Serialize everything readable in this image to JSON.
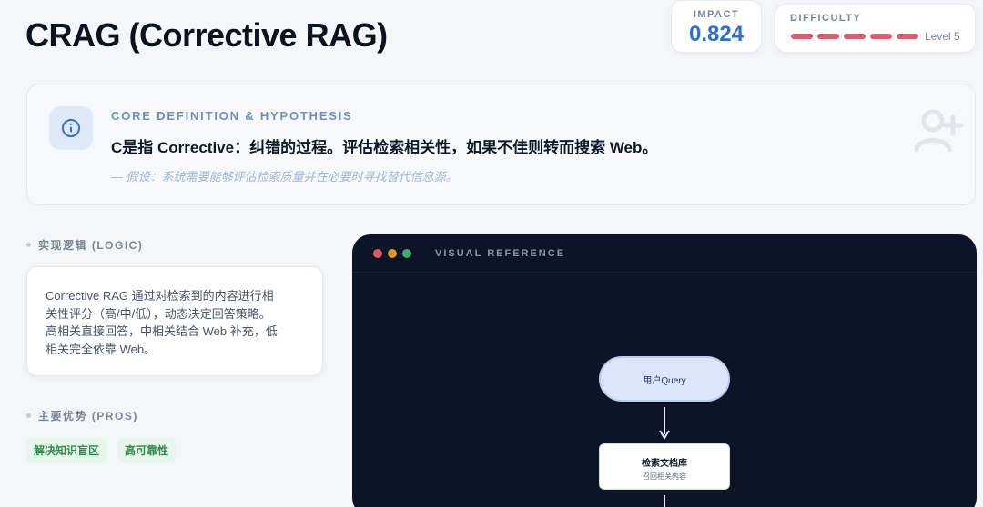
{
  "page": {
    "title": "CRAG (Corrective RAG)"
  },
  "impact": {
    "label": "IMPACT",
    "value": "0.824"
  },
  "difficulty": {
    "label": "DIFFICULTY",
    "level_text": "Level 5",
    "level": 5,
    "max": 5,
    "color": "#e05a70"
  },
  "definition": {
    "heading": "CORE DEFINITION & HYPOTHESIS",
    "main": "C是指 Corrective：纠错的过程。评估检索相关性，如果不佳则转而搜索 Web。",
    "hypothesis": "— 假设：系统需要能够评估检索质量并在必要时寻找替代信息源。",
    "icon": "info-icon",
    "side_icon": "add-user-icon"
  },
  "logic": {
    "label": "实现逻辑 (LOGIC)",
    "lines": [
      "Corrective RAG 通过对检索到的内容进行相",
      "关性评分（高/中/低），动态决定回答策略。",
      "高相关直接回答，中相关结合 Web 补充，低",
      "相关完全依靠 Web。"
    ]
  },
  "pros": {
    "label": "主要优势 (PROS)",
    "tags": [
      "解决知识盲区",
      "高可靠性"
    ]
  },
  "visual": {
    "title": "VISUAL REFERENCE",
    "dot_colors": [
      "#e05a5a",
      "#d89a2b",
      "#3fae6a"
    ],
    "nodes": {
      "query": "用户Query",
      "retrieve_title": "检索文档库",
      "retrieve_sub": "召回相关内容"
    }
  },
  "colors": {
    "accent": "#2f6fd6",
    "success": "#2f8a4c",
    "danger": "#e05a70"
  }
}
